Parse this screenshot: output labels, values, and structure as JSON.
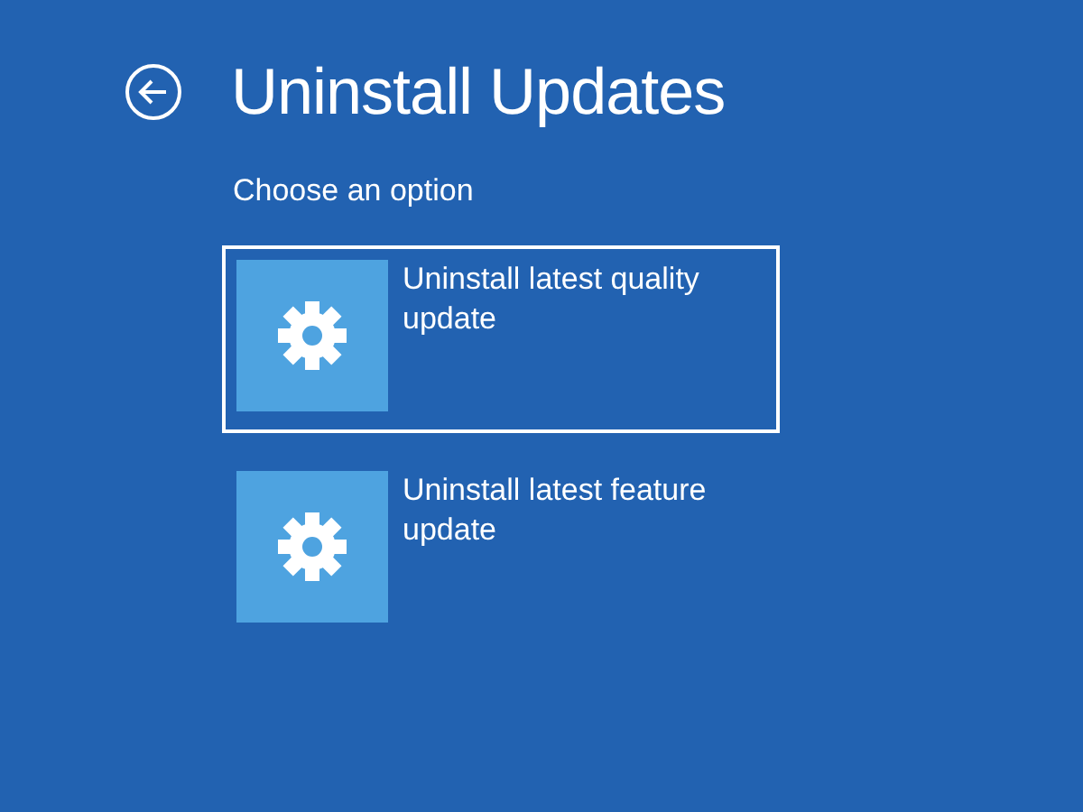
{
  "header": {
    "title": "Uninstall Updates"
  },
  "subtitle": "Choose an option",
  "options": [
    {
      "label": "Uninstall latest quality update",
      "selected": true
    },
    {
      "label": "Uninstall latest feature update",
      "selected": false
    }
  ]
}
